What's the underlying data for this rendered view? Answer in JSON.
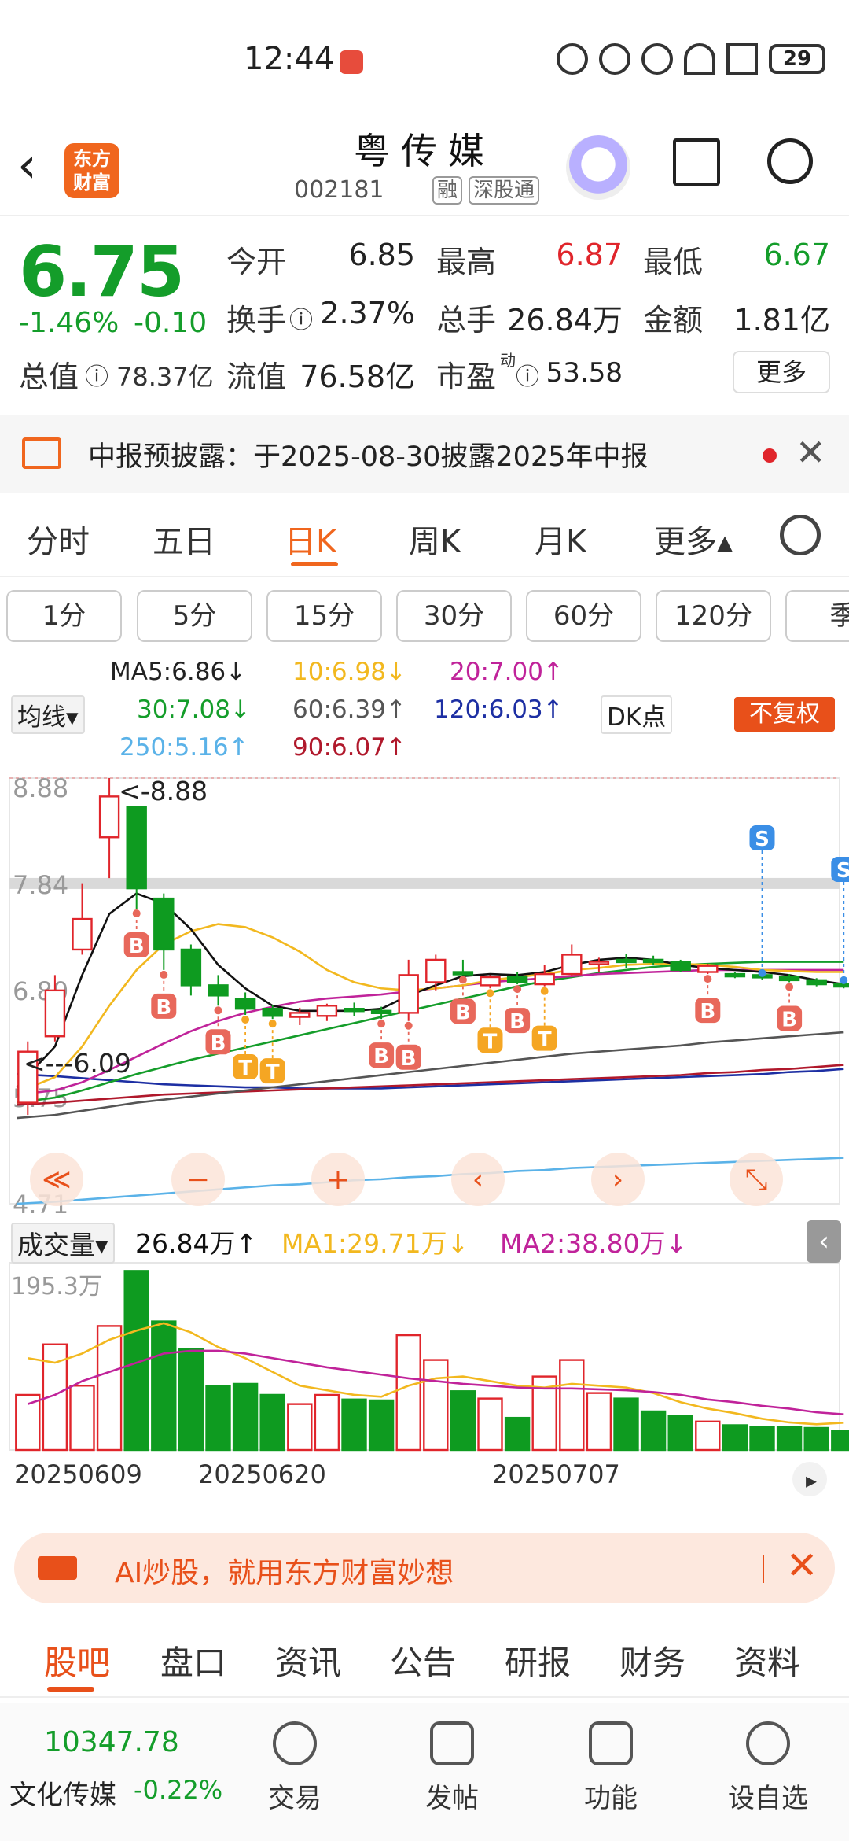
{
  "status_bar": {
    "time": "12:44",
    "battery": "29"
  },
  "header": {
    "title": "粤传媒",
    "logo_text": "东方财富",
    "code": "002181",
    "tags": [
      "融",
      "深股通"
    ]
  },
  "quote": {
    "price": "6.75",
    "change_pct": "-1.46%",
    "change": "-0.10",
    "total_value_label": "总值",
    "total_value": "78.37亿",
    "fields": [
      {
        "label": "今开",
        "value": "6.85",
        "color": "#222222"
      },
      {
        "label": "最高",
        "value": "6.87",
        "color": "#e0252b"
      },
      {
        "label": "最低",
        "value": "6.67",
        "color": "#149d2a"
      },
      {
        "label": "换手",
        "value": "2.37%",
        "color": "#222222"
      },
      {
        "label": "总手",
        "value": "26.84万",
        "color": "#222222"
      },
      {
        "label": "金额",
        "value": "1.81亿",
        "color": "#222222"
      },
      {
        "label": "流值",
        "value": "76.58亿",
        "color": "#222222"
      },
      {
        "label": "市盈",
        "value": "53.58",
        "color": "#222222"
      }
    ],
    "more_label": "更多"
  },
  "notice": {
    "text": "中报预披露：于2025-08-30披露2025年中报"
  },
  "chart_tabs": [
    "分时",
    "五日",
    "日K",
    "周K",
    "月K",
    "更多▴"
  ],
  "active_chart_tab": "日K",
  "periods": [
    "1分",
    "5分",
    "15分",
    "30分",
    "60分",
    "120分",
    "季"
  ],
  "ma_legend": {
    "selector": "均线▾",
    "items": [
      {
        "text": "MA5:6.86↓",
        "color": "#222222"
      },
      {
        "text": "10:6.98↓",
        "color": "#f2b81f"
      },
      {
        "text": "20:7.00↑",
        "color": "#c0239a"
      },
      {
        "text": "30:7.08↓",
        "color": "#149d2a"
      },
      {
        "text": "60:6.39↑",
        "color": "#555555"
      },
      {
        "text": "120:6.03↑",
        "color": "#1d2fa3"
      },
      {
        "text": "250:5.16↑",
        "color": "#5ab2e8"
      },
      {
        "text": "90:6.07↑",
        "color": "#b0182b"
      }
    ],
    "dk_label": "DK点",
    "adjust_label": "不复权"
  },
  "chart_axis": {
    "y_labels": [
      "8.88",
      "7.84",
      "6.80",
      "5.75",
      "4.71"
    ],
    "max_marker": "<-8.88",
    "min_marker": "<---6.09"
  },
  "chart_controls": [
    "≪",
    "−",
    "+",
    "‹",
    "›",
    "⤡"
  ],
  "volume": {
    "selector": "成交量▾",
    "value": "26.84万↑",
    "ma1": "MA1:29.71万↓",
    "ma2": "MA2:38.80万↓",
    "ymax_label": "195.3万"
  },
  "x_labels": [
    "20250609",
    "20250620",
    "20250707"
  ],
  "chart_data": {
    "type": "candlestick",
    "title": "",
    "xlabel": "",
    "ylabel": "",
    "ylim": [
      4.71,
      8.88
    ],
    "candles": [
      {
        "o": 5.7,
        "h": 6.3,
        "l": 5.58,
        "c": 6.2,
        "up": true
      },
      {
        "o": 6.35,
        "h": 6.95,
        "l": 6.3,
        "c": 6.8,
        "up": true
      },
      {
        "o": 7.2,
        "h": 7.85,
        "l": 7.15,
        "c": 7.5,
        "up": true
      },
      {
        "o": 8.3,
        "h": 8.88,
        "l": 7.9,
        "c": 8.7,
        "up": true
      },
      {
        "o": 8.6,
        "h": 8.6,
        "l": 7.6,
        "c": 7.8,
        "up": false
      },
      {
        "o": 7.7,
        "h": 7.75,
        "l": 7.0,
        "c": 7.2,
        "up": false
      },
      {
        "o": 7.2,
        "h": 7.25,
        "l": 6.75,
        "c": 6.85,
        "up": false
      },
      {
        "o": 6.85,
        "h": 6.95,
        "l": 6.65,
        "c": 6.75,
        "up": false
      },
      {
        "o": 6.72,
        "h": 6.78,
        "l": 6.56,
        "c": 6.62,
        "up": false
      },
      {
        "o": 6.62,
        "h": 6.66,
        "l": 6.52,
        "c": 6.55,
        "up": false
      },
      {
        "o": 6.54,
        "h": 6.63,
        "l": 6.46,
        "c": 6.58,
        "up": true
      },
      {
        "o": 6.55,
        "h": 6.67,
        "l": 6.5,
        "c": 6.65,
        "up": true
      },
      {
        "o": 6.62,
        "h": 6.68,
        "l": 6.55,
        "c": 6.6,
        "up": false
      },
      {
        "o": 6.6,
        "h": 6.64,
        "l": 6.52,
        "c": 6.58,
        "up": false
      },
      {
        "o": 6.58,
        "h": 7.1,
        "l": 6.5,
        "c": 6.95,
        "up": true
      },
      {
        "o": 6.88,
        "h": 7.15,
        "l": 6.8,
        "c": 7.1,
        "up": true
      },
      {
        "o": 6.98,
        "h": 7.1,
        "l": 6.95,
        "c": 6.96,
        "up": false
      },
      {
        "o": 6.85,
        "h": 6.95,
        "l": 6.82,
        "c": 6.93,
        "up": true
      },
      {
        "o": 6.93,
        "h": 6.98,
        "l": 6.86,
        "c": 6.88,
        "up": false
      },
      {
        "o": 6.86,
        "h": 7.05,
        "l": 6.84,
        "c": 6.96,
        "up": true
      },
      {
        "o": 6.96,
        "h": 7.25,
        "l": 6.94,
        "c": 7.15,
        "up": true
      },
      {
        "o": 7.08,
        "h": 7.12,
        "l": 6.98,
        "c": 7.08,
        "up": true
      },
      {
        "o": 7.1,
        "h": 7.16,
        "l": 7.02,
        "c": 7.08,
        "up": false
      },
      {
        "o": 7.1,
        "h": 7.14,
        "l": 7.05,
        "c": 7.08,
        "up": false
      },
      {
        "o": 7.08,
        "h": 7.1,
        "l": 6.98,
        "c": 7.0,
        "up": false
      },
      {
        "o": 6.98,
        "h": 7.06,
        "l": 6.96,
        "c": 7.04,
        "up": true
      },
      {
        "o": 6.96,
        "h": 6.98,
        "l": 6.92,
        "c": 6.94,
        "up": false
      },
      {
        "o": 6.94,
        "h": 6.97,
        "l": 6.9,
        "c": 6.95,
        "up": false
      },
      {
        "o": 6.93,
        "h": 6.96,
        "l": 6.88,
        "c": 6.9,
        "up": false
      },
      {
        "o": 6.9,
        "h": 6.92,
        "l": 6.84,
        "c": 6.86,
        "up": false
      },
      {
        "o": 6.86,
        "h": 6.9,
        "l": 6.82,
        "c": 6.85,
        "up": false
      }
    ],
    "signals": [
      {
        "i": 4,
        "label": "B",
        "color": "#e8685b"
      },
      {
        "i": 5,
        "label": "B",
        "color": "#e8685b"
      },
      {
        "i": 7,
        "label": "B",
        "color": "#e8685b"
      },
      {
        "i": 8,
        "label": "T",
        "color": "#f5a623"
      },
      {
        "i": 9,
        "label": "T",
        "color": "#f5a623"
      },
      {
        "i": 13,
        "label": "B",
        "color": "#e8685b"
      },
      {
        "i": 14,
        "label": "B",
        "color": "#e8685b"
      },
      {
        "i": 16,
        "label": "B",
        "color": "#e8685b"
      },
      {
        "i": 17,
        "label": "T",
        "color": "#f5a623"
      },
      {
        "i": 18,
        "label": "B",
        "color": "#e8685b"
      },
      {
        "i": 19,
        "label": "T",
        "color": "#f5a623"
      },
      {
        "i": 25,
        "label": "B",
        "color": "#e8685b"
      },
      {
        "i": 28,
        "label": "B",
        "color": "#e8685b"
      },
      {
        "i": 27,
        "label": "S",
        "color": "#3a8ee6"
      },
      {
        "i": 30,
        "label": "S",
        "color": "#3a8ee6"
      }
    ],
    "volume": [
      60,
      115,
      70,
      135,
      195,
      140,
      110,
      70,
      72,
      60,
      50,
      60,
      55,
      54,
      125,
      98,
      64,
      56,
      35,
      80,
      98,
      62,
      56,
      42,
      37,
      31,
      27,
      25,
      25,
      24,
      21
    ],
    "vol_max": 195.3,
    "ma_lines": {
      "ma5": {
        "color": "#111111",
        "values": [
          5.85,
          6.25,
          6.95,
          7.55,
          7.75,
          7.65,
          7.4,
          7.05,
          6.82,
          6.65,
          6.6,
          6.6,
          6.6,
          6.62,
          6.75,
          6.85,
          6.94,
          6.96,
          6.95,
          6.98,
          7.05,
          7.1,
          7.12,
          7.1,
          7.05,
          7.02,
          7.0,
          6.98,
          6.95,
          6.9,
          6.86
        ]
      },
      "ma10": {
        "color": "#f2b81f",
        "values": [
          5.8,
          5.95,
          6.25,
          6.65,
          7.0,
          7.25,
          7.38,
          7.45,
          7.42,
          7.32,
          7.18,
          7.0,
          6.88,
          6.82,
          6.8,
          6.82,
          6.85,
          6.9,
          6.93,
          6.96,
          7.0,
          7.02,
          7.05,
          7.06,
          7.06,
          7.05,
          7.03,
          7.0,
          6.99,
          6.98,
          6.98
        ]
      },
      "ma20": {
        "color": "#c0239a",
        "values": [
          5.78,
          5.82,
          5.9,
          6.02,
          6.15,
          6.28,
          6.4,
          6.5,
          6.58,
          6.64,
          6.69,
          6.72,
          6.74,
          6.76,
          6.79,
          6.82,
          6.85,
          6.88,
          6.9,
          6.92,
          6.94,
          6.96,
          6.97,
          6.98,
          6.99,
          7.0,
          7.0,
          7.0,
          7.0,
          7.0,
          7.0
        ]
      },
      "ma30": {
        "color": "#149d2a",
        "values": [
          5.7,
          5.75,
          5.82,
          5.9,
          5.98,
          6.05,
          6.12,
          6.18,
          6.24,
          6.3,
          6.36,
          6.42,
          6.48,
          6.54,
          6.6,
          6.66,
          6.72,
          6.78,
          6.84,
          6.89,
          6.93,
          6.97,
          7.0,
          7.03,
          7.05,
          7.06,
          7.07,
          7.08,
          7.08,
          7.08,
          7.08
        ]
      },
      "ma60": {
        "color": "#555555",
        "values": [
          5.55,
          5.58,
          5.62,
          5.66,
          5.7,
          5.73,
          5.76,
          5.79,
          5.82,
          5.85,
          5.88,
          5.91,
          5.94,
          5.97,
          6.0,
          6.03,
          6.06,
          6.09,
          6.12,
          6.15,
          6.18,
          6.2,
          6.22,
          6.24,
          6.26,
          6.29,
          6.31,
          6.33,
          6.35,
          6.37,
          6.39
        ]
      },
      "ma90": {
        "color": "#b0182b",
        "values": [
          5.68,
          5.7,
          5.72,
          5.74,
          5.76,
          5.78,
          5.79,
          5.8,
          5.81,
          5.82,
          5.83,
          5.84,
          5.85,
          5.86,
          5.87,
          5.88,
          5.89,
          5.9,
          5.91,
          5.92,
          5.93,
          5.94,
          5.95,
          5.96,
          5.97,
          5.99,
          6.0,
          6.02,
          6.03,
          6.05,
          6.07
        ]
      },
      "ma120": {
        "color": "#1d2fa3",
        "values": [
          5.98,
          5.96,
          5.94,
          5.92,
          5.9,
          5.88,
          5.87,
          5.86,
          5.85,
          5.85,
          5.84,
          5.84,
          5.84,
          5.84,
          5.85,
          5.86,
          5.87,
          5.88,
          5.89,
          5.9,
          5.91,
          5.92,
          5.93,
          5.94,
          5.95,
          5.96,
          5.97,
          5.98,
          6.0,
          6.01,
          6.03
        ]
      },
      "ma250": {
        "color": "#5ab2e8",
        "values": [
          4.71,
          4.73,
          4.75,
          4.77,
          4.79,
          4.81,
          4.83,
          4.85,
          4.87,
          4.89,
          4.9,
          4.92,
          4.94,
          4.95,
          4.97,
          4.98,
          5.0,
          5.01,
          5.03,
          5.04,
          5.06,
          5.07,
          5.08,
          5.09,
          5.1,
          5.11,
          5.12,
          5.13,
          5.14,
          5.15,
          5.16
        ]
      },
      "vma1": {
        "color": "#f2b81f",
        "values": [
          100,
          95,
          105,
          120,
          130,
          138,
          128,
          112,
          100,
          85,
          70,
          65,
          60,
          58,
          70,
          78,
          80,
          75,
          70,
          68,
          72,
          70,
          68,
          62,
          52,
          45,
          40,
          34,
          30,
          28,
          29.71
        ]
      },
      "vma2": {
        "color": "#c0239a",
        "values": [
          50,
          60,
          75,
          85,
          95,
          105,
          108,
          108,
          105,
          100,
          95,
          90,
          86,
          82,
          78,
          75,
          72,
          70,
          68,
          67,
          67,
          66,
          65,
          63,
          60,
          55,
          52,
          48,
          45,
          41,
          38.8
        ]
      }
    }
  },
  "ai_banner": {
    "text": "AI炒股，就用东方财富妙想"
  },
  "sub_tabs": [
    "股吧",
    "盘口",
    "资讯",
    "公告",
    "研报",
    "财务",
    "资料"
  ],
  "active_sub_tab": "股吧",
  "bottom_bar": {
    "index_value": "10347.78",
    "index_name": "文化传媒",
    "index_change": "-0.22%",
    "items": [
      "交易",
      "发帖",
      "功能",
      "设自选"
    ]
  }
}
